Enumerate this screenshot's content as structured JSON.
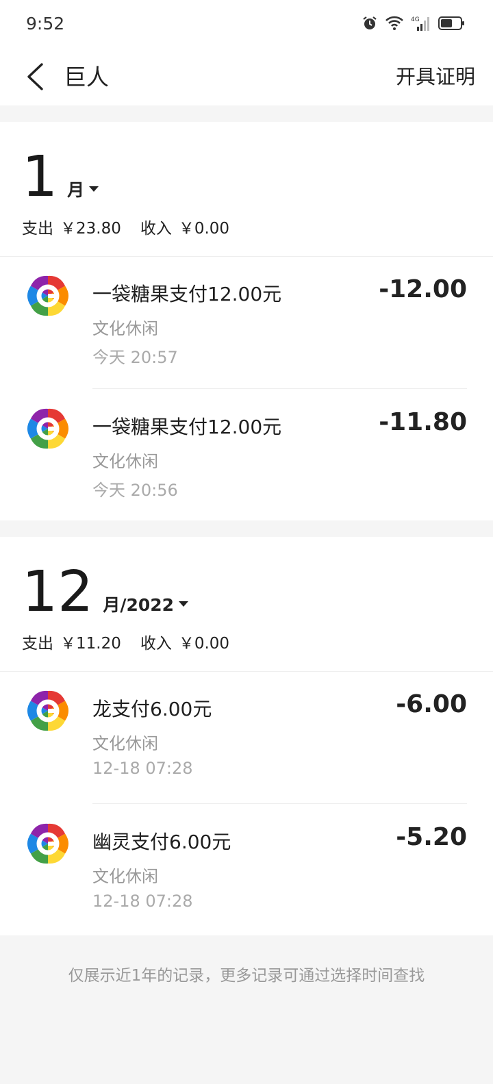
{
  "status_bar": {
    "time": "9:52",
    "network": "4G"
  },
  "nav": {
    "title": "巨人",
    "action": "开具证明"
  },
  "months": [
    {
      "month": "1",
      "unit": "月",
      "summary": {
        "expense_label": "支出",
        "expense": "￥23.80",
        "income_label": "收入",
        "income": "￥0.00"
      },
      "transactions": [
        {
          "title": "一袋糖果支付12.00元",
          "category": "文化休闲",
          "time": "今天  20:57",
          "amount": "-12.00"
        },
        {
          "title": "一袋糖果支付12.00元",
          "category": "文化休闲",
          "time": "今天  20:56",
          "amount": "-11.80"
        }
      ]
    },
    {
      "month": "12",
      "unit": "月/2022",
      "summary": {
        "expense_label": "支出",
        "expense": "￥11.20",
        "income_label": "收入",
        "income": "￥0.00"
      },
      "transactions": [
        {
          "title": "龙支付6.00元",
          "category": "文化休闲",
          "time": "12-18  07:28",
          "amount": "-6.00"
        },
        {
          "title": "幽灵支付6.00元",
          "category": "文化休闲",
          "time": "12-18  07:28",
          "amount": "-5.20"
        }
      ]
    }
  ],
  "footer": {
    "note": "仅展示近1年的记录，更多记录可通过选择时间查找"
  },
  "colors": {
    "background": "#f5f5f5",
    "card": "#ffffff",
    "text": "#1f1f1f",
    "muted": "#999999"
  },
  "icons": [
    "alarm-icon",
    "wifi-icon",
    "signal-icon",
    "battery-icon",
    "back-arrow-icon",
    "merchant-logo-icon",
    "dropdown-caret-icon"
  ]
}
